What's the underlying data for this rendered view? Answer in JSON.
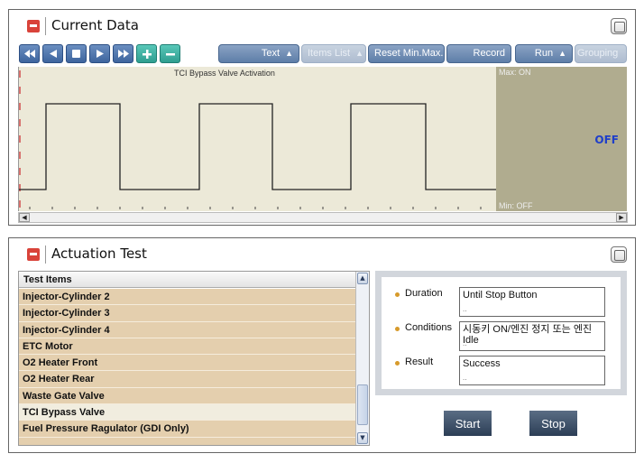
{
  "current_data": {
    "title": "Current Data",
    "toolbar": {
      "text_label": "Text",
      "items_list_label": "Items List",
      "reset_label": "Reset Min.Max.",
      "record_label": "Record",
      "run_label": "Run",
      "grouping_label": "Grouping"
    },
    "graph": {
      "title": "TCI Bypass Valve Activation",
      "max_label": "Max: ON",
      "min_label": "Min: OFF",
      "current_value": "OFF",
      "signal_states": [
        "OFF",
        "ON",
        "OFF",
        "ON",
        "OFF",
        "ON",
        "OFF"
      ]
    }
  },
  "actuation_test": {
    "title": "Actuation Test",
    "list_header": "Test Items",
    "items": [
      "Injector-Cylinder 2",
      "Injector-Cylinder 3",
      "Injector-Cylinder 4",
      "ETC Motor",
      "O2 Heater Front",
      "O2 Heater Rear",
      "Waste Gate Valve",
      "TCI Bypass Valve",
      "Fuel Pressure Ragulator (GDI Only)"
    ],
    "selected_item": "TCI Bypass Valve",
    "duration_label": "Duration",
    "duration_value": "Until Stop Button",
    "conditions_label": "Conditions",
    "conditions_value": "시동키 ON/엔진 정지 또는 엔진 Idle",
    "result_label": "Result",
    "result_value": "Success",
    "start_label": "Start",
    "stop_label": "Stop"
  }
}
